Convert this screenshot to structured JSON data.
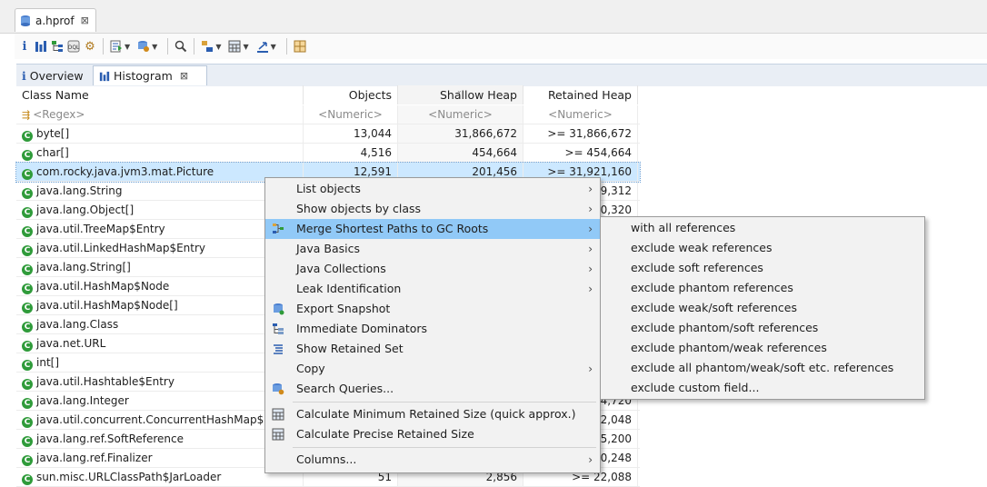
{
  "editor_tab": {
    "title": "a.hprof",
    "close": "⊠"
  },
  "view_tabs": [
    {
      "label": "Overview",
      "icon": "info-icon"
    },
    {
      "label": "Histogram",
      "icon": "histogram-icon",
      "close": "⊠"
    }
  ],
  "table": {
    "headers": [
      "Class Name",
      "Objects",
      "Shallow Heap",
      "Retained Heap"
    ],
    "filter": [
      "<Regex>",
      "<Numeric>",
      "<Numeric>",
      "<Numeric>"
    ],
    "rows": [
      {
        "name": "byte[]",
        "objects": "13,044",
        "shallow": "31,866,672",
        "retained": ">= 31,866,672"
      },
      {
        "name": "char[]",
        "objects": "4,516",
        "shallow": "454,664",
        "retained": ">= 454,664"
      },
      {
        "name": "com.rocky.java.jvm3.mat.Picture",
        "objects": "12,591",
        "shallow": "201,456",
        "retained": ">= 31,921,160"
      },
      {
        "name": "java.lang.String",
        "objects": "",
        "shallow": "",
        "retained": "9,312"
      },
      {
        "name": "java.lang.Object[]",
        "objects": "",
        "shallow": "",
        "retained": "0,320"
      },
      {
        "name": "java.util.TreeMap$Entry",
        "objects": "",
        "shallow": "",
        "retained": ""
      },
      {
        "name": "java.util.LinkedHashMap$Entry",
        "objects": "",
        "shallow": "",
        "retained": ""
      },
      {
        "name": "java.lang.String[]",
        "objects": "",
        "shallow": "",
        "retained": ""
      },
      {
        "name": "java.util.HashMap$Node",
        "objects": "",
        "shallow": "",
        "retained": ""
      },
      {
        "name": "java.util.HashMap$Node[]",
        "objects": "",
        "shallow": "",
        "retained": ""
      },
      {
        "name": "java.lang.Class",
        "objects": "",
        "shallow": "",
        "retained": ""
      },
      {
        "name": "java.net.URL",
        "objects": "",
        "shallow": "",
        "retained": ""
      },
      {
        "name": "int[]",
        "objects": "",
        "shallow": "",
        "retained": ""
      },
      {
        "name": "java.util.Hashtable$Entry",
        "objects": "",
        "shallow": "",
        "retained": ""
      },
      {
        "name": "java.lang.Integer",
        "objects": "",
        "shallow": "",
        "retained": "4,720"
      },
      {
        "name": "java.util.concurrent.ConcurrentHashMap$Node",
        "objects": "",
        "shallow": "",
        "retained": "2,048"
      },
      {
        "name": "java.lang.ref.SoftReference",
        "objects": "",
        "shallow": "",
        "retained": "5,200"
      },
      {
        "name": "java.lang.ref.Finalizer",
        "objects": "",
        "shallow": "",
        "retained": "0,248"
      },
      {
        "name": "sun.misc.URLClassPath$JarLoader",
        "objects": "51",
        "shallow": "2,856",
        "retained": ">= 22,088"
      }
    ]
  },
  "context_menu": {
    "items": [
      {
        "label": "List objects",
        "submenu": true
      },
      {
        "label": "Show objects by class",
        "submenu": true
      },
      {
        "label": "Merge Shortest Paths to GC Roots",
        "submenu": true,
        "icon": "merge-paths-icon",
        "highlighted": true
      },
      {
        "label": "Java Basics",
        "submenu": true
      },
      {
        "label": "Java Collections",
        "submenu": true
      },
      {
        "label": "Leak Identification",
        "submenu": true
      },
      {
        "label": "Export Snapshot",
        "icon": "export-snapshot-icon"
      },
      {
        "label": "Immediate Dominators",
        "icon": "dominators-icon"
      },
      {
        "label": "Show Retained Set",
        "icon": "retained-set-icon"
      },
      {
        "label": "Copy",
        "submenu": true
      },
      {
        "label": "Search Queries...",
        "icon": "search-queries-icon"
      },
      {
        "label": "Calculate Minimum Retained Size (quick approx.)",
        "icon": "calculator-icon",
        "separator_before": true
      },
      {
        "label": "Calculate Precise Retained Size",
        "icon": "calculator-icon"
      },
      {
        "label": "Columns...",
        "submenu": true,
        "separator_before": true
      }
    ],
    "submenu": [
      "with all references",
      "exclude weak references",
      "exclude soft references",
      "exclude phantom references",
      "exclude weak/soft references",
      "exclude phantom/soft references",
      "exclude phantom/weak references",
      "exclude all phantom/weak/soft etc. references",
      "exclude custom field..."
    ]
  }
}
